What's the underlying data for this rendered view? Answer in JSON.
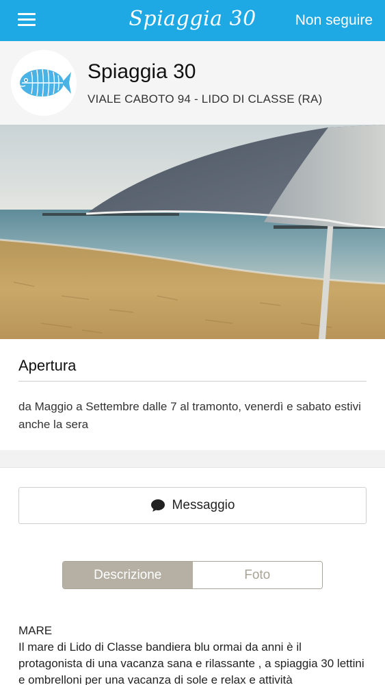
{
  "header": {
    "brand": "Spiaggia 30",
    "follow_label": "Non seguire"
  },
  "profile": {
    "name": "Spiaggia 30",
    "address": "VIALE CABOTO 94 - LIDO DI CLASSE (RA)"
  },
  "opening": {
    "title": "Apertura",
    "text": "da Maggio a Settembre  dalle 7 al tramonto, venerdì e sabato estivi anche la sera"
  },
  "message_button": {
    "label": "Messaggio"
  },
  "tabs": [
    {
      "label": "Descrizione",
      "active": true
    },
    {
      "label": "Foto",
      "active": false
    }
  ],
  "description": {
    "heading": "MARE",
    "text": "Il mare di Lido di Classe bandiera blu ormai da anni  è il protagonista di una vacanza sana e rilassante , a spiaggia 30 lettini e ombrelloni per una vacanza di sole e relax  e  attività"
  },
  "colors": {
    "header_bg": "#1ea8e4",
    "segment_active": "#b5b0a3",
    "logo_blue": "#4ab3e6"
  },
  "icons": [
    "menu-icon",
    "fish-logo-icon",
    "chat-bubble-icon"
  ]
}
